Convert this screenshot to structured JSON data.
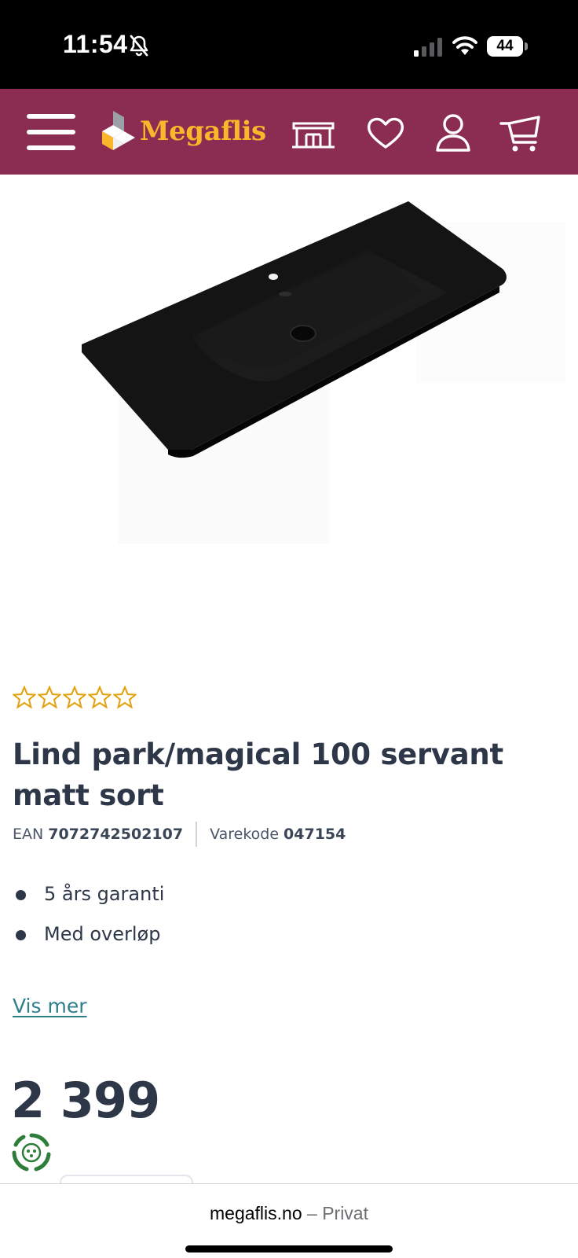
{
  "status_bar": {
    "time": "11:54",
    "battery": "44",
    "icons": [
      "bell-slash-icon",
      "cellular-signal-icon",
      "wifi-icon",
      "battery-icon"
    ]
  },
  "header": {
    "brand": "Megaflis",
    "background_color": "#8b2d52",
    "brand_color": "#fbb72b",
    "icons": [
      "hamburger-menu-icon",
      "store-icon",
      "heart-icon",
      "account-icon",
      "cart-icon"
    ]
  },
  "product": {
    "rating_stars": 0,
    "rating_max": 5,
    "title": "Lind park/magical 100 servant matt sort",
    "ean_label": "EAN",
    "ean_value": "7072742502107",
    "code_label": "Varekode",
    "code_value": "047154",
    "features": [
      "5 års garanti",
      "Med overløp"
    ],
    "show_more": "Vis mer",
    "price": "2 399",
    "star_color": "#e3a008",
    "link_color": "#2e7e8c"
  },
  "browser": {
    "domain": "megaflis.no",
    "mode": "– Privat"
  }
}
